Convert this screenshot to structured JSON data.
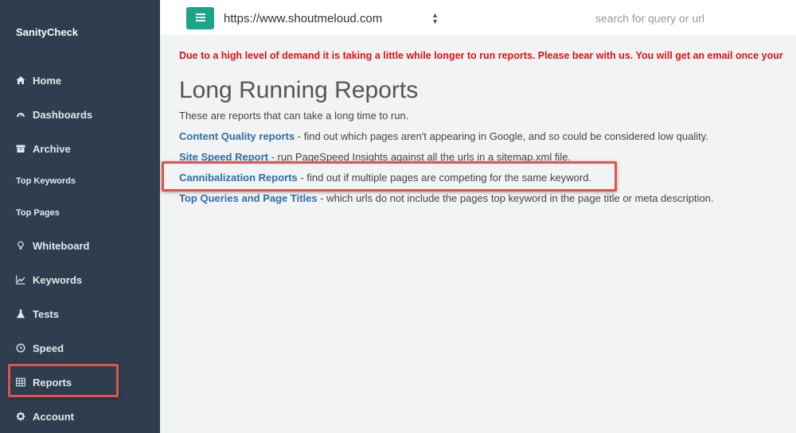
{
  "app": {
    "brand": "SanityCheck"
  },
  "sidebar": {
    "items": [
      {
        "label": "Home",
        "icon": "home-icon"
      },
      {
        "label": "Dashboards",
        "icon": "dashboard-icon"
      },
      {
        "label": "Archive",
        "icon": "archive-icon"
      },
      {
        "label": "Top Keywords"
      },
      {
        "label": "Top Pages"
      },
      {
        "label": "Whiteboard",
        "icon": "lightbulb-icon"
      },
      {
        "label": "Keywords",
        "icon": "line-chart-icon"
      },
      {
        "label": "Tests",
        "icon": "flask-icon"
      },
      {
        "label": "Speed",
        "icon": "clock-icon"
      },
      {
        "label": "Reports",
        "icon": "table-icon"
      },
      {
        "label": "Account",
        "icon": "gear-icon"
      }
    ]
  },
  "topbar": {
    "site_value": "https://www.shoutmeloud.com",
    "search_placeholder": "search for query or url"
  },
  "main": {
    "alert": "Due to a high level of demand it is taking a little while longer to run reports. Please bear with us. You will get an email once your",
    "title": "Long Running Reports",
    "intro": "These are reports that can take a long time to run.",
    "reports": [
      {
        "link": "Content Quality reports",
        "desc": " - find out which pages aren't appearing in Google, and so could be considered low quality."
      },
      {
        "link": "Site Speed Report",
        "desc": " - run PageSpeed Insights against all the urls in a sitemap.xml file."
      },
      {
        "link": "Cannibalization Reports",
        "desc": " - find out if multiple pages are competing for the same keyword."
      },
      {
        "link": "Top Queries and Page Titles",
        "desc": " - which urls do not include the pages top keyword in the page title or meta description."
      }
    ]
  },
  "colors": {
    "sidebar_bg": "#2f3e4e",
    "accent": "#1aa588",
    "alert": "#e0120f",
    "link": "#2e6fa8",
    "highlight": "#e0544c"
  }
}
